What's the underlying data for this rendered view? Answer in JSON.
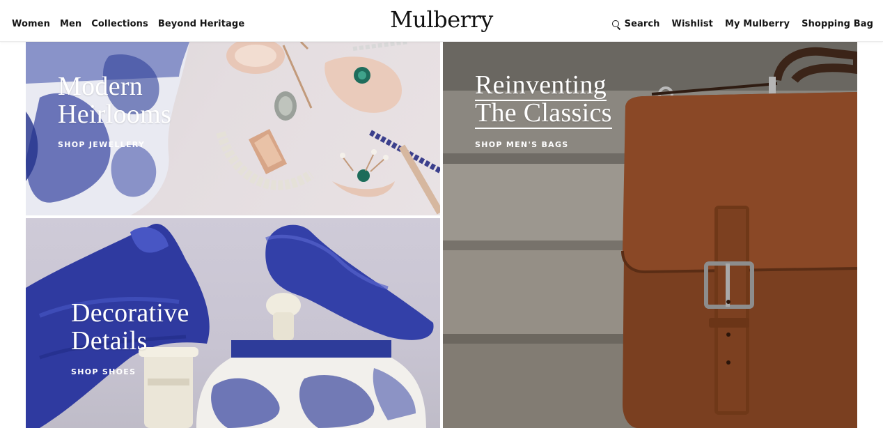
{
  "header": {
    "logo": "Mulberry",
    "nav_left": [
      {
        "label": "Women"
      },
      {
        "label": "Men"
      },
      {
        "label": "Collections"
      },
      {
        "label": "Beyond Heritage"
      }
    ],
    "nav_right": {
      "search": "Search",
      "wishlist": "Wishlist",
      "account": "My Mulberry",
      "bag": "Shopping Bag"
    }
  },
  "tiles": {
    "jewellery": {
      "title_line1": "Modern",
      "title_line2": "Heirlooms",
      "cta": "SHOP JEWELLERY"
    },
    "mens_bags": {
      "title_line1": "Reinventing",
      "title_line2": "The Classics",
      "cta": "SHOP MEN'S BAGS"
    },
    "shoes": {
      "title_line1": "Decorative",
      "title_line2": "Details",
      "cta": "SHOP SHOES"
    }
  }
}
